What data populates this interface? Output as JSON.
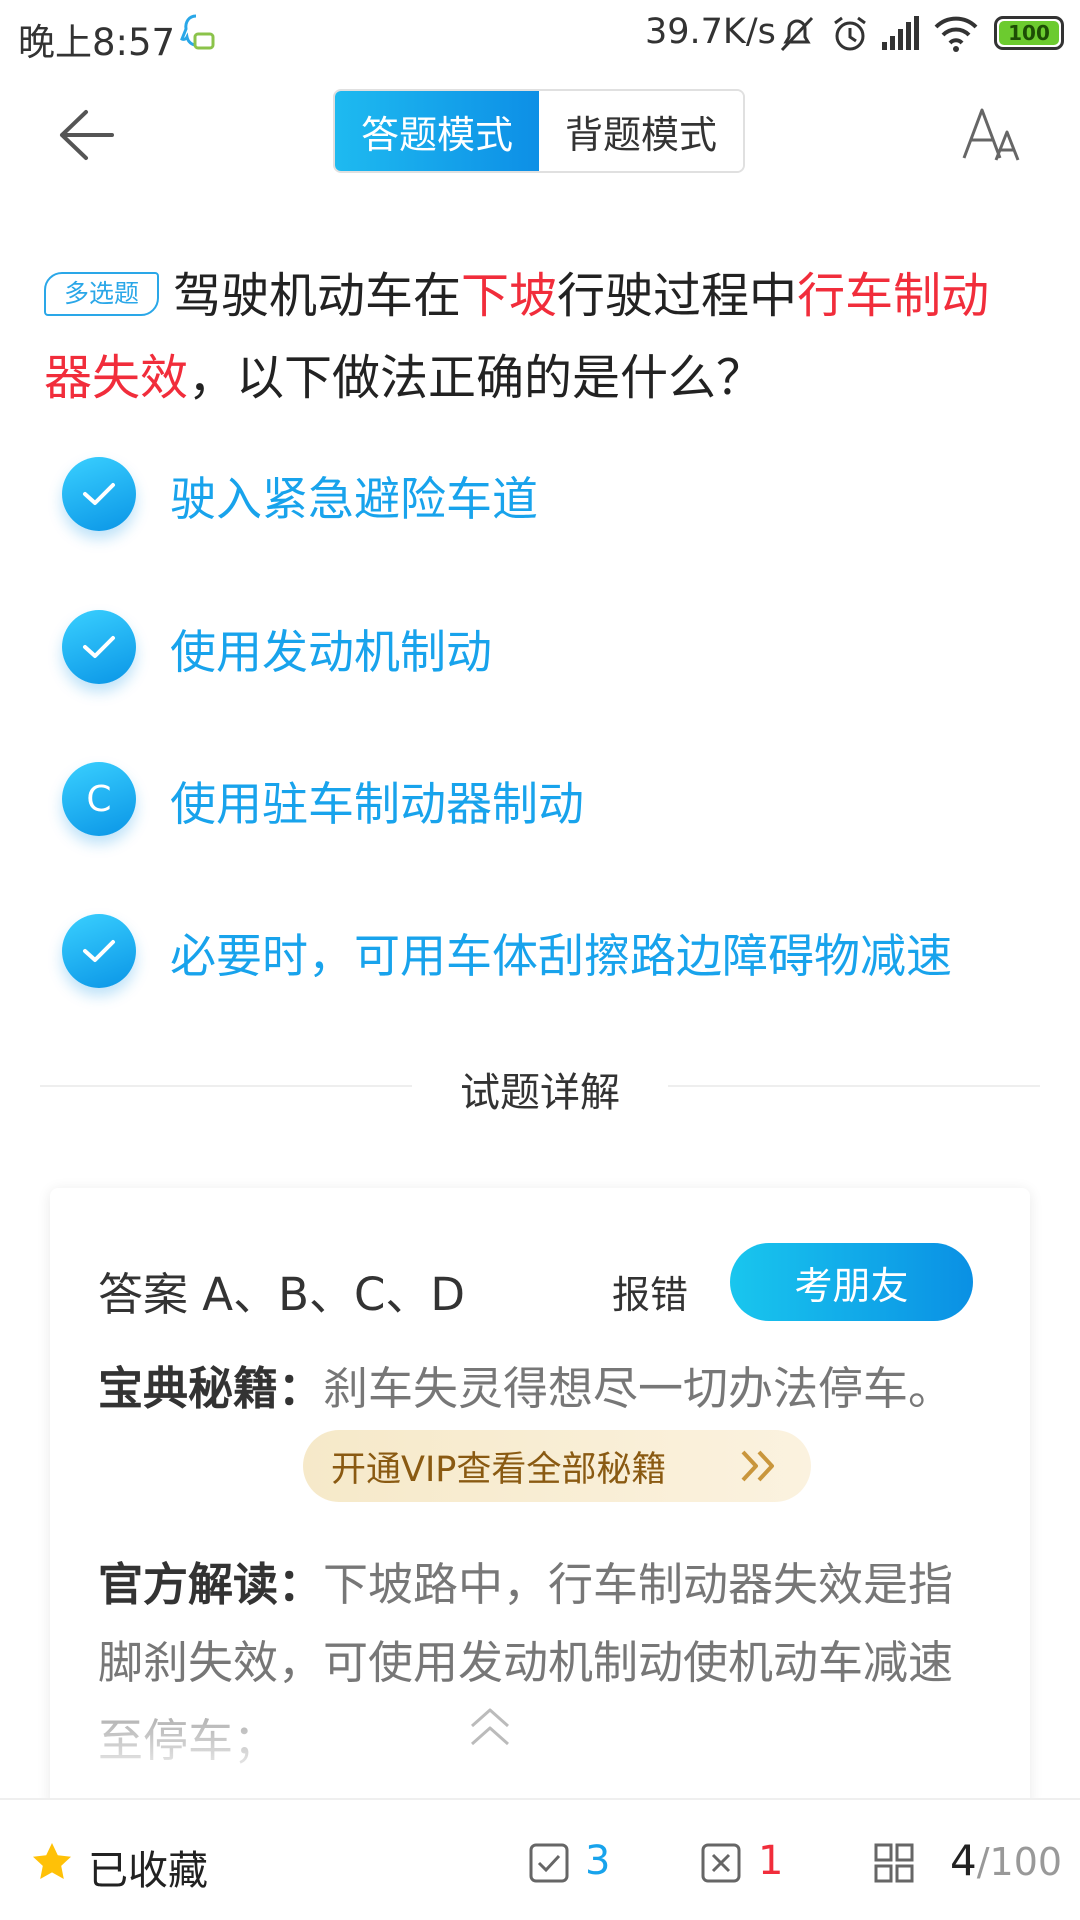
{
  "status_bar": {
    "time": "晚上8:57",
    "net_speed": "39.7K/s",
    "battery": "100",
    "icons": [
      "qq-notification-icon",
      "mute-icon",
      "alarm-icon",
      "signal-icon",
      "wifi-icon",
      "battery-icon"
    ]
  },
  "nav": {
    "back_icon": "back-arrow-icon",
    "mode_tabs": [
      {
        "label": "答题模式",
        "active": true
      },
      {
        "label": "背题模式",
        "active": false
      }
    ],
    "font_icon": "font-size-icon"
  },
  "question": {
    "type_badge": "多选题",
    "parts": [
      "驾驶机动车在",
      "下坡",
      "行驶过程中",
      "行车制动器失效",
      "，以下做法正确的是什么？"
    ],
    "highlight_color": "#f12d3b"
  },
  "options": [
    {
      "marker": "check",
      "text": "驶入紧急避险车道"
    },
    {
      "marker": "check",
      "text": "使用发动机制动"
    },
    {
      "marker": "C",
      "text": "使用驻车制动器制动"
    },
    {
      "marker": "check",
      "text": "必要时，可用车体刮擦路边障碍物减速"
    }
  ],
  "explain": {
    "section_title": "试题详解",
    "answer": "答案  A、B、C、D",
    "report_label": "报错",
    "friend_label": "考朋友",
    "tip_label": "宝典秘籍：",
    "tip_text": "刹车失灵得想尽一切办法停车。",
    "vip_label": "开通VIP查看全部秘籍",
    "official_label": "官方解读：",
    "official_text": "下坡路中，行车制动器失效是指脚刹失效，可使用发动机制动使机动车减速至停车；"
  },
  "bottom": {
    "fav_label": "已收藏",
    "correct_count": "3",
    "wrong_count": "1",
    "page_current": "4",
    "page_total": "/100",
    "colors": {
      "accent": "#18a3ec",
      "correct": "#18a3ec",
      "wrong": "#f12d3b",
      "star": "#ffc107"
    }
  }
}
